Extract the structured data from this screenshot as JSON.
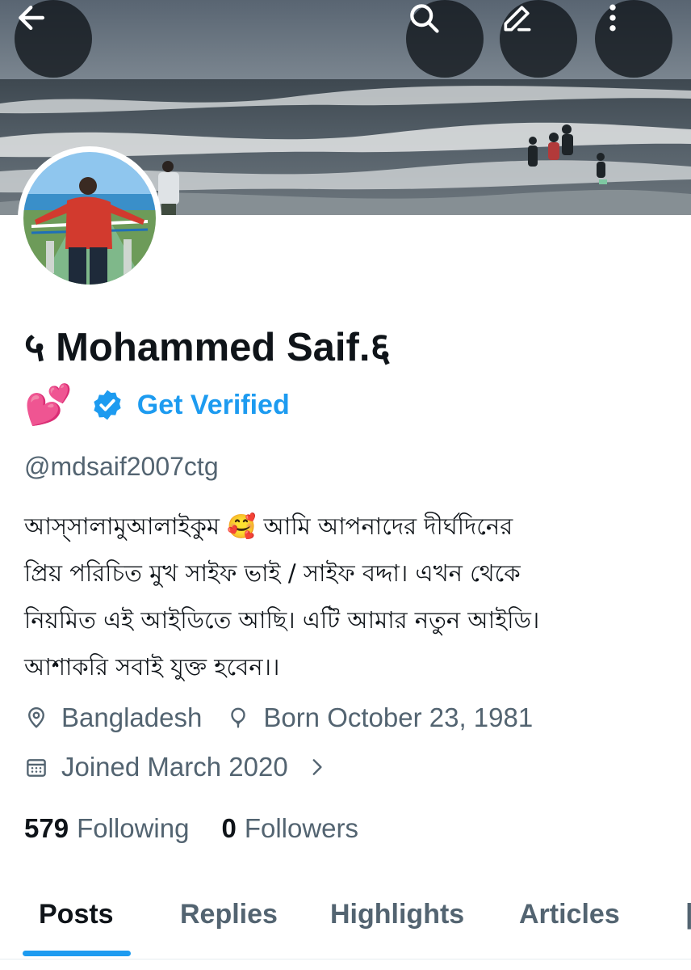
{
  "header": {
    "back_icon": "arrow-left-icon",
    "search_icon": "search-icon",
    "edit_icon": "pencil-icon",
    "more_icon": "more-vertical-icon"
  },
  "profile": {
    "display_name": "५ Mohammed Saif.६",
    "emoji": "💕",
    "verified_label": "Get Verified",
    "handle": "@mdsaif2007ctg",
    "bio_lines": [
      "আস্সালামুআলাইকুম 🥰 আমি আপনাদের দীর্ঘদিনের",
      "প্রিয় পরিচিত মুখ সাইফ ভাই / সাইফ বদ্দা। এখন থেকে",
      "নিয়মিত এই আইডিতে আছি। এটি আমার নতুন আইডি।",
      "আশাকরি সবাই যুক্ত হবেন।।"
    ],
    "location": "Bangladesh",
    "birthday": "Born October 23, 1981",
    "joined": "Joined March 2020"
  },
  "stats": {
    "following_count": "579",
    "following_label": "Following",
    "followers_count": "0",
    "followers_label": "Followers"
  },
  "tabs": [
    {
      "label": "Posts",
      "active": true
    },
    {
      "label": "Replies",
      "active": false
    },
    {
      "label": "Highlights",
      "active": false
    },
    {
      "label": "Articles",
      "active": false
    }
  ],
  "colors": {
    "accent": "#1d9bf0",
    "text_primary": "#0f1419",
    "text_secondary": "#536471"
  }
}
